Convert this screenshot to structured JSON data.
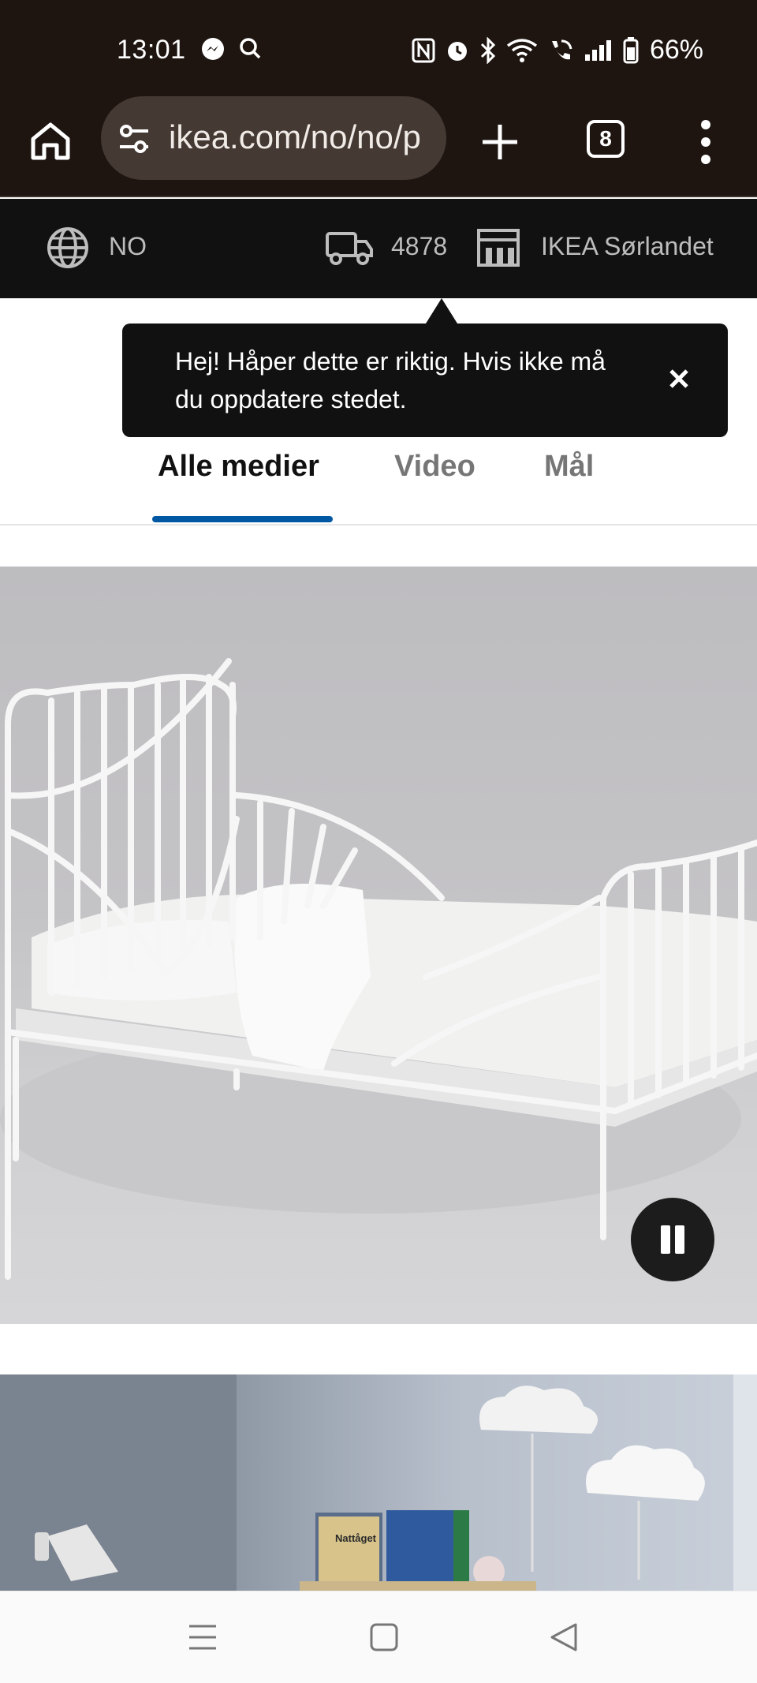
{
  "status_bar": {
    "time": "13:01",
    "battery": "66%",
    "icons": [
      "messenger-icon",
      "search-icon",
      "nfc-icon",
      "alarm-icon",
      "bluetooth-icon",
      "wifi-icon",
      "wifi-call-icon",
      "signal-icon",
      "battery-icon"
    ]
  },
  "browser": {
    "url": "ikea.com/no/no/p",
    "tab_count": "8"
  },
  "ikea_header": {
    "language": "NO",
    "postal_code": "4878",
    "store": "IKEA Sørlandet"
  },
  "tooltip": {
    "message": "Hej! Håper dette er riktig. Hvis ikke må du oppdatere stedet."
  },
  "media_tabs": [
    {
      "label": "Alle medier",
      "active": true
    },
    {
      "label": "Video",
      "active": false
    },
    {
      "label": "Mål",
      "active": false
    }
  ],
  "media": {
    "book_titles": [
      "Nattåget",
      ""
    ]
  },
  "colors": {
    "accent": "#0058a3",
    "browser_bg": "#1e1511",
    "strip_bg": "#111111"
  }
}
